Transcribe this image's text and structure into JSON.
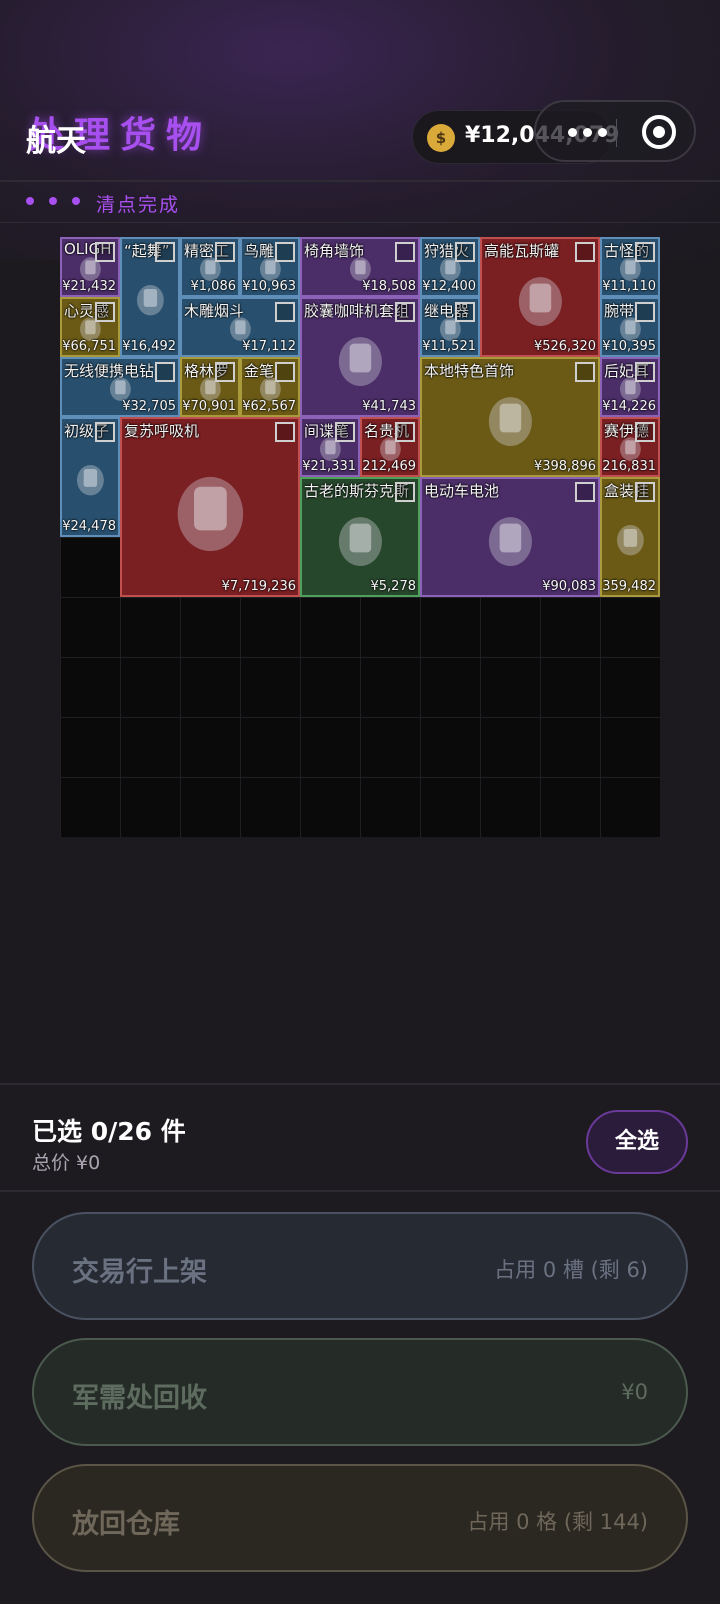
{
  "header": {
    "title": "处理货物",
    "app_name": "航天",
    "currency_symbol": "$",
    "balance": "¥12,044,079"
  },
  "status": {
    "text": "清点完成"
  },
  "items": [
    {
      "name": "OLIGH",
      "price": "¥21,432",
      "rarity": "purple",
      "icon": "gadget-icon"
    },
    {
      "name": "“起舞”",
      "price": "¥16,492",
      "rarity": "blue",
      "icon": "dancer-statue-icon"
    },
    {
      "name": "精密工",
      "price": "¥1,086",
      "rarity": "blue",
      "icon": "tool-case-icon"
    },
    {
      "name": "鸟雕",
      "price": "¥10,963",
      "rarity": "blue",
      "icon": "bird-carving-icon"
    },
    {
      "name": "椅角墙饰",
      "price": "¥18,508",
      "rarity": "purple",
      "icon": "horn-wall-decor-icon"
    },
    {
      "name": "狩猎火",
      "price": "¥12,400",
      "rarity": "blue",
      "icon": "hunting-lighter-icon"
    },
    {
      "name": "高能瓦斯罐",
      "price": "¥526,320",
      "rarity": "red",
      "icon": "gas-canister-icon"
    },
    {
      "name": "古怪的",
      "price": "¥11,110",
      "rarity": "blue",
      "icon": "odd-object-icon"
    },
    {
      "name": "心灵感",
      "price": "¥66,751",
      "rarity": "gold",
      "icon": "mind-device-icon"
    },
    {
      "name": "木雕烟斗",
      "price": "¥17,112",
      "rarity": "blue",
      "icon": "wooden-pipe-icon"
    },
    {
      "name": "胶囊咖啡机套组",
      "price": "¥41,743",
      "rarity": "purple",
      "icon": "coffee-machine-icon"
    },
    {
      "name": "继电器",
      "price": "¥11,521",
      "rarity": "blue",
      "icon": "relay-icon"
    },
    {
      "name": "腕带",
      "price": "¥10,395",
      "rarity": "blue",
      "icon": "wristband-icon"
    },
    {
      "name": "无线便携电钻",
      "price": "¥32,705",
      "rarity": "blue",
      "icon": "drill-icon"
    },
    {
      "name": "格林罗",
      "price": "¥70,901",
      "rarity": "gold",
      "icon": "compass-icon"
    },
    {
      "name": "金笔",
      "price": "¥62,567",
      "rarity": "gold",
      "icon": "gold-pen-icon"
    },
    {
      "name": "本地特色首饰",
      "price": "¥398,896",
      "rarity": "gold",
      "icon": "jewelry-icon"
    },
    {
      "name": "后妃耳",
      "price": "¥14,226",
      "rarity": "purple",
      "icon": "earring-icon"
    },
    {
      "name": "初级子",
      "price": "¥24,478",
      "rarity": "blue",
      "icon": "ammo-box-icon"
    },
    {
      "name": "复苏呼吸机",
      "price": "¥7,719,236",
      "rarity": "red",
      "icon": "ventilator-icon"
    },
    {
      "name": "间谍笔",
      "price": "¥21,331",
      "rarity": "purple",
      "icon": "spy-pen-icon"
    },
    {
      "name": "名贵机",
      "price": "¥212,469",
      "rarity": "red",
      "icon": "luxury-watch-icon"
    },
    {
      "name": "赛伊德",
      "price": "¥216,831",
      "rarity": "red",
      "icon": "trinket-icon"
    },
    {
      "name": "古老的斯芬克斯",
      "price": "¥5,278",
      "rarity": "green",
      "icon": "sphinx-statue-icon"
    },
    {
      "name": "电动车电池",
      "price": "¥90,083",
      "rarity": "purple",
      "icon": "ev-battery-icon"
    },
    {
      "name": "盒装挂",
      "price": "¥359,482",
      "rarity": "gold",
      "icon": "boxed-item-icon"
    }
  ],
  "selection": {
    "count_text": "已选 0/26 件",
    "total_text": "总价  ¥0",
    "select_all_label": "全选"
  },
  "actions": {
    "market": {
      "label": "交易行上架",
      "info": "占用 0 槽 (剩 6)"
    },
    "recycle": {
      "label": "军需处回收",
      "info": "¥0"
    },
    "return": {
      "label": "放回仓库",
      "info": "占用 0 格 (剩 144)"
    }
  },
  "colors": {
    "accent": "#a84ff0",
    "rarity_purple": "#4b2d68",
    "rarity_blue": "#28506e",
    "rarity_gold": "#6a5a16",
    "rarity_red": "#7a1f22",
    "rarity_green": "#27472c"
  }
}
